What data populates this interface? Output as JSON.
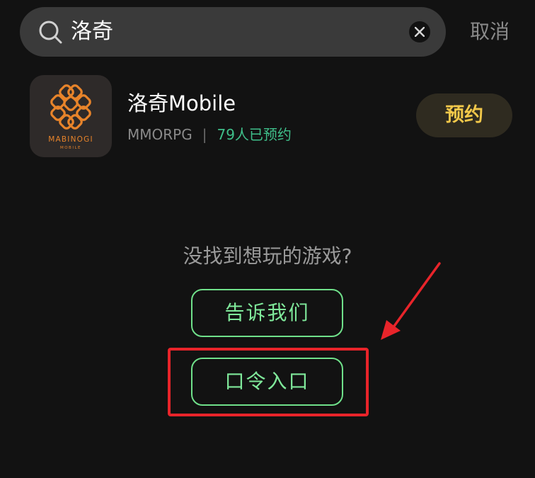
{
  "search": {
    "query": "洛奇",
    "cancel_label": "取消"
  },
  "result": {
    "title": "洛奇Mobile",
    "genre": "MMORPG",
    "separator": "|",
    "reservations": "79人已预约",
    "reserve_label": "预约",
    "icon_label": "MABINOGI",
    "icon_sublabel": "MOBILE"
  },
  "empty_prompt": {
    "text": "没找到想玩的游戏?",
    "tell_us_label": "告诉我们",
    "code_entry_label": "口令入口"
  },
  "colors": {
    "background": "#121212",
    "accent_green": "#6fe08a",
    "reserve_gold": "#f2c84a",
    "annotation_red": "#e8242a"
  }
}
